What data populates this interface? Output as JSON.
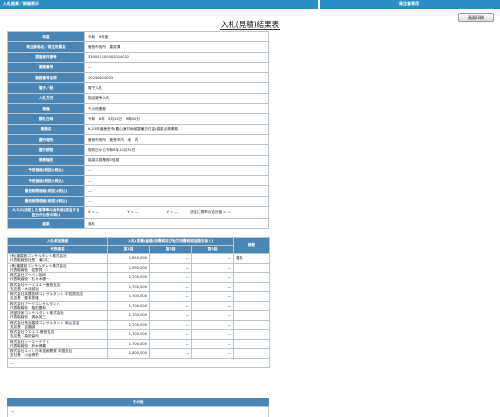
{
  "header": {
    "left_title": "入札結果／詳細表示",
    "right_title": "発注者専用"
  },
  "buttons": {
    "print": "画面印刷"
  },
  "doc_title": "入札(見積)結果表",
  "info_rows": [
    {
      "key": "年度",
      "val": "令和　6年度"
    },
    {
      "key": "発注部局名／発注所属名",
      "val": "鹿島市役所　建設課"
    },
    {
      "key": "調達案件番号",
      "val": "330001100002024032"
    },
    {
      "key": "業務番号",
      "val": "—"
    },
    {
      "key": "業務番号名称",
      "val": "20240624005"
    },
    {
      "key": "電子／紙",
      "val": "電子入札"
    },
    {
      "key": "入札方式",
      "val": "指名競争入札"
    },
    {
      "key": "業種",
      "val": "その他業務"
    },
    {
      "key": "開札日時",
      "val": "令和　6年　6月24日　9時00分"
    },
    {
      "key": "業務名",
      "val": "6-23年度鹿島市(農山漁村地域整備交付金)橋梁点検業務"
    },
    {
      "key": "履行場所",
      "val": "鹿島市役所　鹿島市内　地　内"
    },
    {
      "key": "履行期限",
      "val": "契約日から令和6年10月31日"
    },
    {
      "key": "業務種別",
      "val": "橋梁点検業務5径橋"
    },
    {
      "key": "予定価格(税抜)(税込)",
      "val": "—"
    },
    {
      "key": "予定価格(税抜)(税込)",
      "val": "—"
    },
    {
      "key": "最低制限価格(税抜)(税込)",
      "val": "—"
    },
    {
      "key": "最低制限価格(税抜)(税込)",
      "val": "—"
    }
  ],
  "formula_row": {
    "key": "X,Y,Z(決定した基準率の合計値(該当する区分が公表の時))",
    "x": "X = —",
    "y": "Y = —",
    "z": "Z = —",
    "result": "決定に基率の合計値 = —"
  },
  "result_row": {
    "key": "結果",
    "val": "落札"
  },
  "bid_table": {
    "h_company": "入札参加業者",
    "h_amount": "入札(見積)金額(消費税及び地方消費税相当額を除く)",
    "h_note": "摘要",
    "h_rep": "代表者名",
    "rounds": [
      "第1回",
      "第2回",
      "第3回"
    ],
    "bidders": [
      {
        "name": "(有)福建設コンサルタント株式会社",
        "rep": "代表取締役社長　滝口仁",
        "r1": "1,850,000",
        "r2": "—",
        "r3": "—",
        "note": "落札"
      },
      {
        "name": "(株)福建設コンサルタント株式会社",
        "rep": "代表取締役　佐野賢",
        "r1": "1,690,000",
        "r2": "—",
        "r3": "—",
        "note": ""
      },
      {
        "name": "株式会社アーバン技研",
        "rep": "代表取締役　杉々木勝一",
        "r1": "1,700,000",
        "r2": "—",
        "r3": "—",
        "note": ""
      },
      {
        "name": "株式会社ケーエスエー鹿島支店",
        "rep": "支店長　大月誠治",
        "r1": "1,700,000",
        "r2": "—",
        "r3": "—",
        "note": ""
      },
      {
        "name": "株式会社芙蓉技研コンサルタント 中四国支店",
        "rep": "支店長　藤本秀雄",
        "r1": "1,700,000",
        "r2": "—",
        "r3": "—",
        "note": ""
      },
      {
        "name": "株式会社アークコンサルタント",
        "rep": "代表取締役　稲田豊和",
        "r1": "1,700,000",
        "r2": "—",
        "r3": "—",
        "note": ""
      },
      {
        "name": "西部技術コンサルタント株式会社",
        "rep": "代表取締役　清水英三",
        "r1": "1,700,000",
        "r2": "—",
        "r3": "—",
        "note": ""
      },
      {
        "name": "株式会社荒谷建設コンサルタント 岡山支店",
        "rep": "支店長　吉國誠",
        "r1": "1,700,000",
        "r2": "—",
        "r3": "—",
        "note": ""
      },
      {
        "name": "株式会社ウエスコ 鹿島支店",
        "rep": "支店長　高松留司",
        "r1": "1,700,000",
        "r2": "—",
        "r3": "—",
        "note": ""
      },
      {
        "name": "株式会社シーエーテクト",
        "rep": "代表取締役　鈴木博義",
        "r1": "1,700,000",
        "r2": "—",
        "r3": "—",
        "note": ""
      },
      {
        "name": "株式会社エイト日本技術開発 中国支社",
        "rep": "支社長　小谷博史",
        "r1": "1,800,000",
        "r2": "—",
        "r3": "—",
        "note": ""
      }
    ],
    "footer": "—"
  },
  "other": {
    "title": "その他",
    "val": "—"
  },
  "colors": {
    "header_bg": "#2a8fc5",
    "label_bg": "#4a86b5",
    "border": "#b8c6d2"
  }
}
